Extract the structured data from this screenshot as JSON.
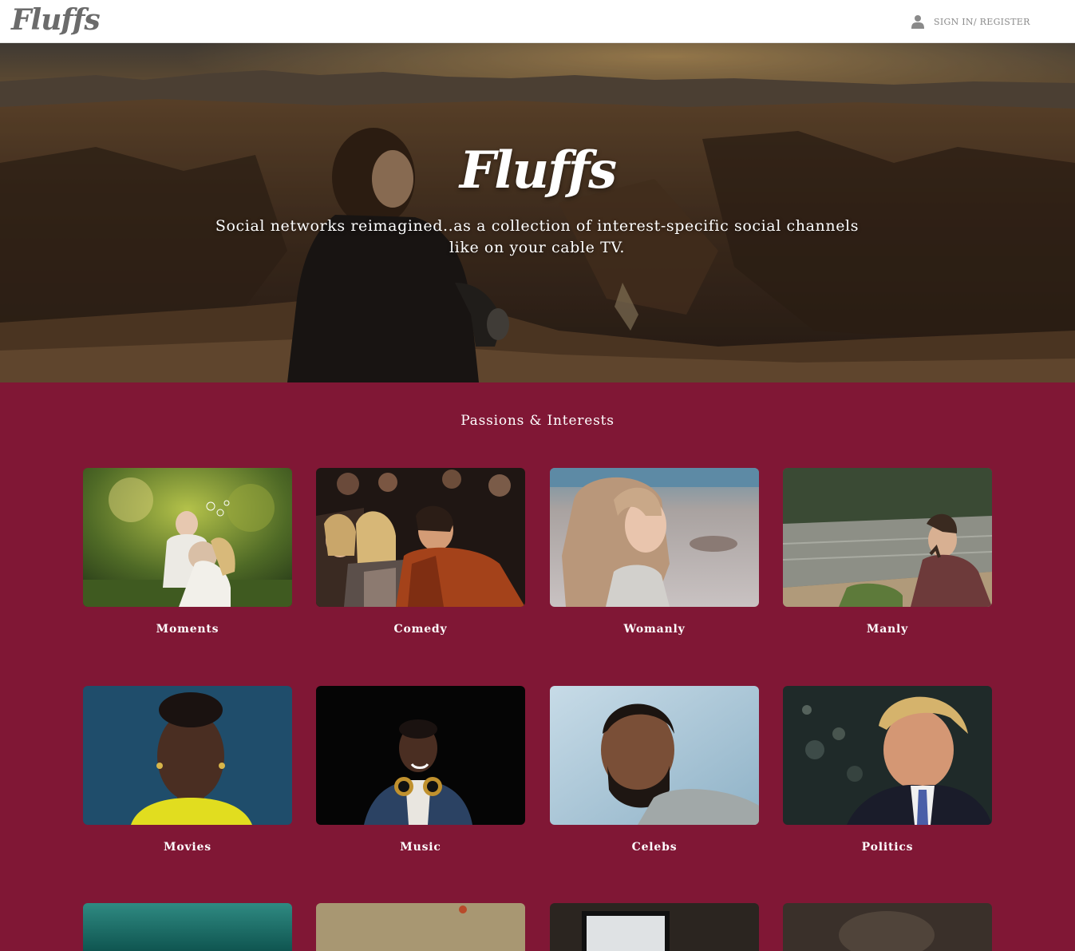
{
  "nav": {
    "logo_text": "Fluffs",
    "signin_label": "SIGN IN/ REGISTER",
    "signin_icon": "user-icon"
  },
  "hero": {
    "title": "Fluffs",
    "tagline": "Social networks reimagined..as a collection of interest-specific social channels like on your cable TV."
  },
  "interests": {
    "title": "Passions & Interests",
    "items": [
      {
        "label": "Moments"
      },
      {
        "label": "Comedy"
      },
      {
        "label": "Womanly"
      },
      {
        "label": "Manly"
      },
      {
        "label": "Movies"
      },
      {
        "label": "Music"
      },
      {
        "label": "Celebs"
      },
      {
        "label": "Politics"
      }
    ]
  },
  "colors": {
    "accent": "#801735",
    "nav_bg": "#ffffff",
    "nav_text": "#8a8a8a",
    "logo": "#6b6b6b"
  }
}
